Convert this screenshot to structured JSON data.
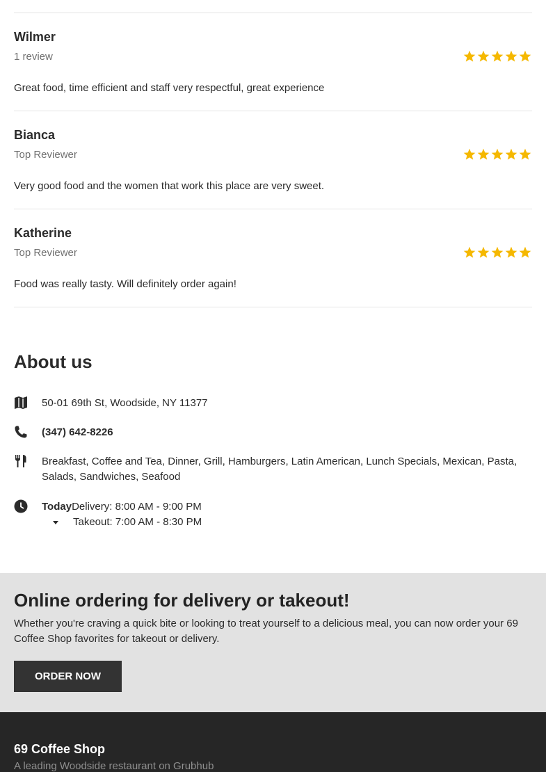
{
  "reviews": [
    {
      "name": "Wilmer",
      "meta": "1 review",
      "rating": 5,
      "text": "Great food, time efficient and staff very respectful, great experience"
    },
    {
      "name": "Bianca",
      "meta": "Top Reviewer",
      "rating": 5,
      "text": "Very good food and the women that work this place are very sweet."
    },
    {
      "name": "Katherine",
      "meta": "Top Reviewer",
      "rating": 5,
      "text": "Food was really tasty. Will definitely order again!"
    }
  ],
  "about": {
    "title": "About us",
    "address": "50-01 69th St, Woodside, NY 11377",
    "phone": "(347) 642-8226",
    "cuisines": "Breakfast, Coffee and Tea, Dinner, Grill, Hamburgers, Latin American, Lunch Specials, Mexican, Pasta, Salads, Sandwiches, Seafood",
    "hours": {
      "today_label": "Today",
      "delivery": "Delivery: 8:00 AM - 9:00 PM",
      "takeout": "Takeout: 7:00 AM - 8:30 PM"
    }
  },
  "order": {
    "title": "Online ordering for delivery or takeout!",
    "text": "Whether you're craving a quick bite or looking to treat yourself to a delicious meal, you can now order your 69 Coffee Shop favorites for takeout or delivery.",
    "button_label": "ORDER NOW"
  },
  "footer": {
    "title": "69 Coffee Shop",
    "subtitle": "A leading Woodside restaurant on Grubhub"
  },
  "colors": {
    "star": "#f5b800",
    "order_bg": "#e2e2e2",
    "button_bg": "#333333",
    "footer_bg": "#262626"
  },
  "icons": {
    "address": "map-icon",
    "phone": "phone-icon",
    "cuisine": "utensils-icon",
    "hours": "clock-icon",
    "rating": "star-icon"
  }
}
